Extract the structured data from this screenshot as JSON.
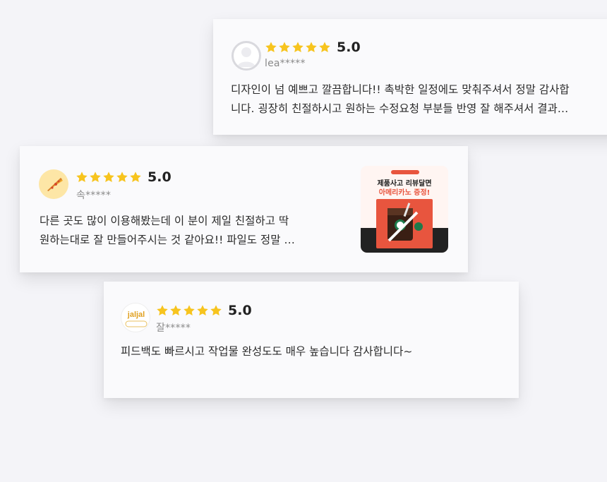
{
  "reviews": [
    {
      "avatar_icon": "default-user-avatar-icon",
      "stars": 5,
      "score": "5.0",
      "reviewer": "lea*****",
      "text_line1": "디자인이 넘 예쁘고 깔끔합니다!! 촉박한 일정에도 맞춰주셔서 정말 감사합",
      "text_line2": "니다. 굉장히 친절하시고 원하는 수정요청 부분들 반영 잘 해주셔서 결과…"
    },
    {
      "avatar_icon": "pizza-avatar-icon",
      "stars": 5,
      "score": "5.0",
      "reviewer": "속*****",
      "text_line1": "다른 곳도 많이 이용해봤는데 이 분이 제일 친절하고 딱",
      "text_line2": "원하는대로 잘 만들어주시는 것 같아요!! 파일도 정말 …",
      "thumbnail": {
        "line1": "제품사고 리뷰달면",
        "line2": "아메리카노 증정!"
      }
    },
    {
      "avatar_icon": "jaljal-logo-avatar",
      "avatar_text": "jaljal",
      "stars": 5,
      "score": "5.0",
      "reviewer": "잘*****",
      "text_line1": "피드백도 빠르시고 작업물 완성도도 매우 높습니다 감사합니다~"
    }
  ],
  "colors": {
    "star": "#f7c41e",
    "background": "#f4f4f8",
    "card": "#fafafc",
    "thumbnail_accent": "#e8553e"
  }
}
